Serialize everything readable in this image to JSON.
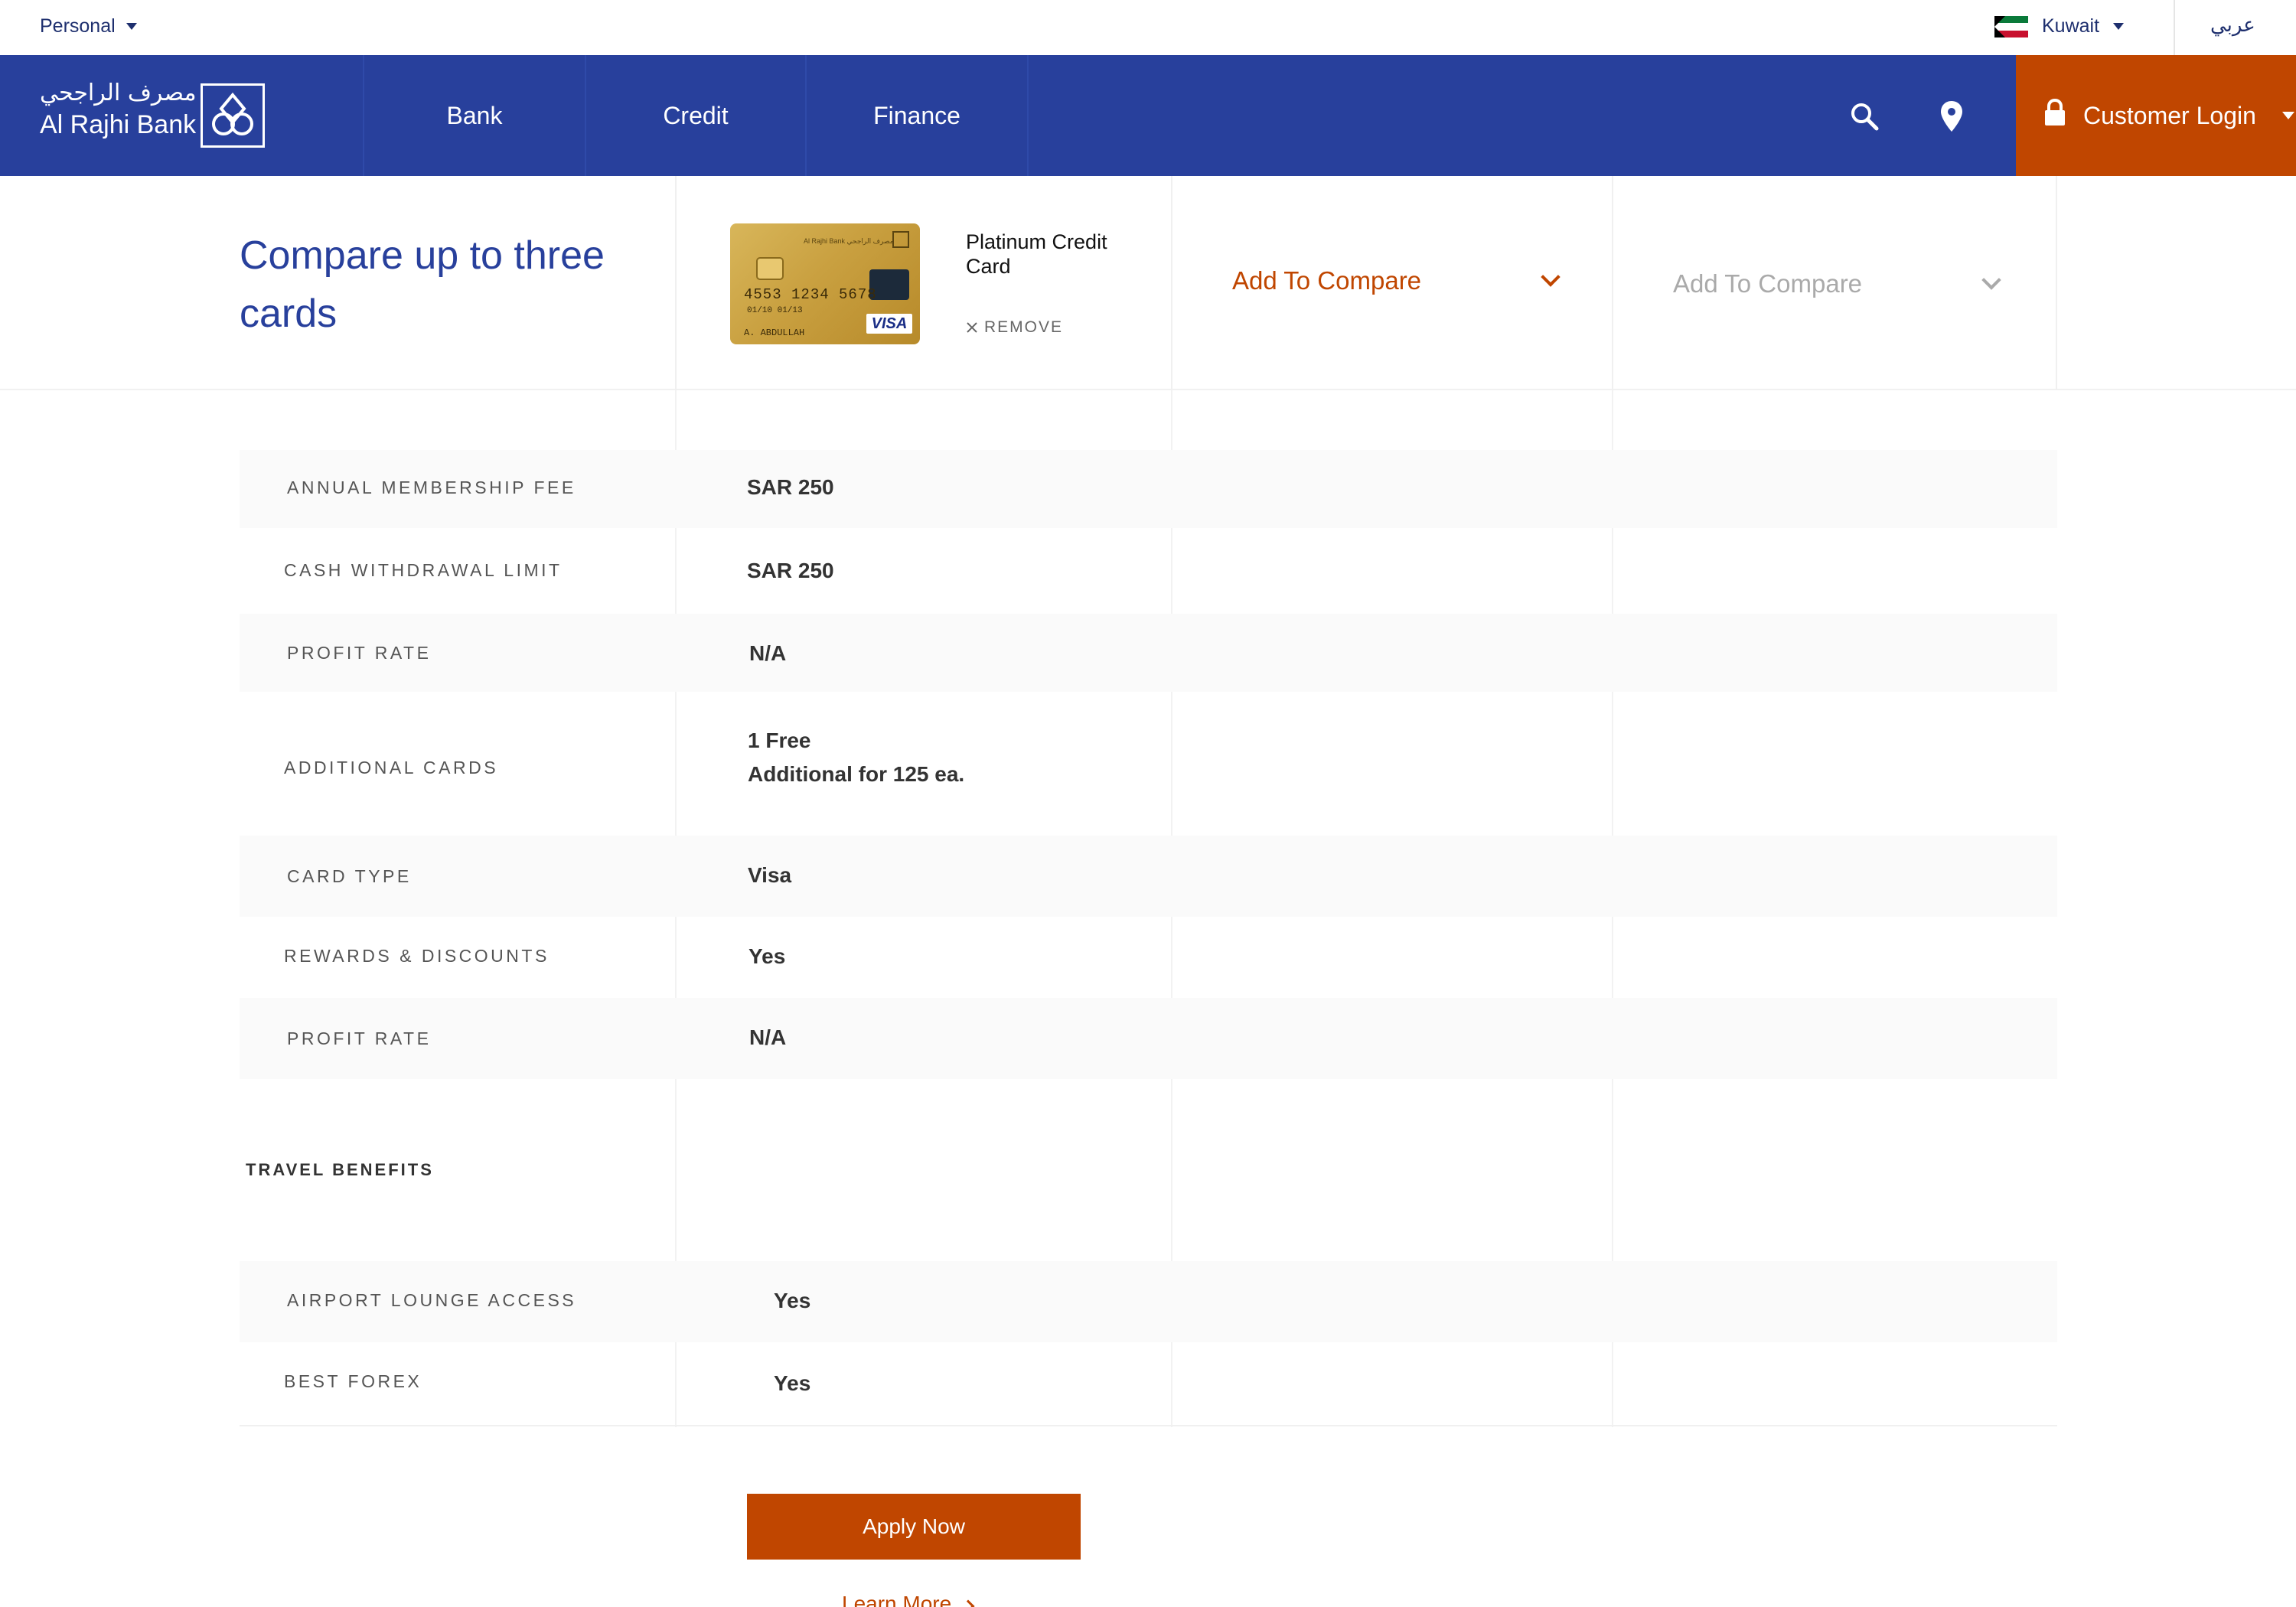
{
  "topbar": {
    "segment": "Personal",
    "country": "Kuwait",
    "language": "عربي"
  },
  "brand": {
    "name_ar": "مصرف الراجحي",
    "name_en": "Al Rajhi Bank"
  },
  "nav": {
    "items": [
      {
        "label": "Bank"
      },
      {
        "label": "Credit"
      },
      {
        "label": "Finance"
      }
    ],
    "login_label": "Customer Login"
  },
  "compare": {
    "title": "Compare up to three cards",
    "card": {
      "name": "Platinum Credit Card",
      "remove_label": "REMOVE",
      "image": {
        "number": "4553 1234 5678",
        "expiry": "01/10  01/13",
        "holder": "A. ABDULLAH",
        "bank_text": "Al Rajhi Bank مصرف الراجحي",
        "network": "VISA"
      }
    },
    "slot2_label": "Add To Compare",
    "slot3_label": "Add To Compare"
  },
  "table": {
    "rows": [
      {
        "label": "ANNUAL MEMBERSHIP FEE",
        "value": "SAR 250"
      },
      {
        "label": "CASH WITHDRAWAL LIMIT",
        "value": "SAR 250"
      },
      {
        "label": "PROFIT RATE",
        "value": "N/A"
      },
      {
        "label": "ADDITIONAL CARDS",
        "value_line1": "1 Free",
        "value_line2": "Additional for 125 ea."
      },
      {
        "label": "CARD TYPE",
        "value": "Visa"
      },
      {
        "label": "REWARDS & DISCOUNTS",
        "value": "Yes"
      },
      {
        "label": "PROFIT RATE",
        "value": "N/A"
      }
    ],
    "section_title": "TRAVEL BENEFITS",
    "travel_rows": [
      {
        "label": "AIRPORT LOUNGE ACCESS",
        "value": "Yes"
      },
      {
        "label": "BEST FOREX",
        "value": "Yes"
      }
    ]
  },
  "actions": {
    "apply_label": "Apply Now",
    "learn_label": "Learn More"
  },
  "colors": {
    "brand_blue": "#28409c",
    "accent_orange": "#c04600"
  }
}
